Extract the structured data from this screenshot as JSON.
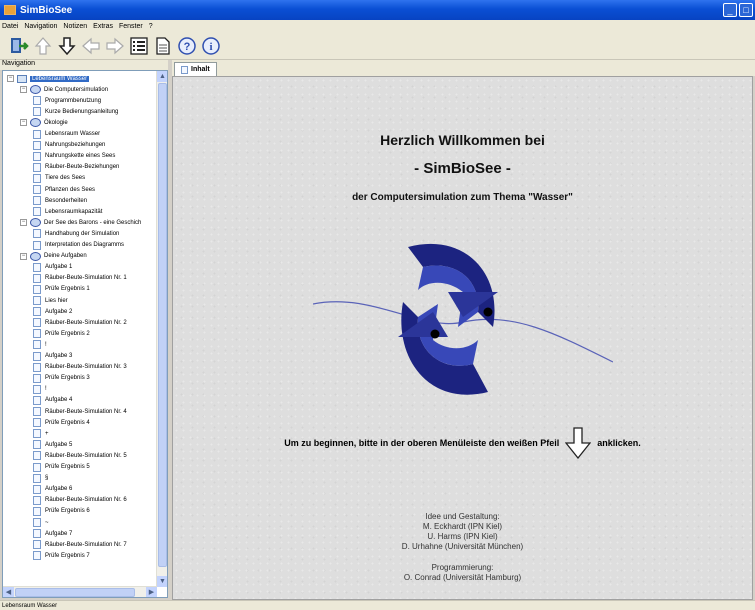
{
  "window": {
    "title": "SimBioSee"
  },
  "menu": [
    "Datei",
    "Navigation",
    "Notizen",
    "Extras",
    "Fenster",
    "?"
  ],
  "toolbar": {
    "icons": [
      "exit-icon",
      "up-icon",
      "down-icon",
      "back-icon",
      "forward-icon",
      "list-icon",
      "page-icon",
      "help-icon",
      "info-icon"
    ]
  },
  "navigation": {
    "label": "Navigation",
    "root": "Lebensraum Wasser",
    "sections": [
      {
        "label": "Die Computersimulation",
        "items": [
          "Programmbenutzung",
          "Kurze Bedienungsanleitung"
        ]
      },
      {
        "label": "Ökologie",
        "items": [
          "Lebensraum Wasser",
          "Nahrungsbeziehungen",
          "Nahrungskette eines Sees",
          "Räuber-Beute-Beziehungen",
          "Tiere des Sees",
          "Pflanzen des Sees",
          "Besonderheiten",
          "Lebensraumkapazität"
        ]
      },
      {
        "label": "Der See des Barons - eine Geschich",
        "items": [
          "Handhabung der Simulation",
          "Interpretation des Diagramms"
        ]
      },
      {
        "label": "Deine Aufgaben",
        "items": [
          "Aufgabe 1",
          "Räuber-Beute-Simulation Nr. 1",
          "Prüfe Ergebnis 1",
          "Lies hier",
          "Aufgabe 2",
          "Räuber-Beute-Simulation Nr. 2",
          "Prüfe Ergebnis 2",
          "!",
          "Aufgabe 3",
          "Räuber-Beute-Simulation Nr. 3",
          "Prüfe Ergebnis 3",
          "!",
          "Aufgabe 4",
          "Räuber-Beute-Simulation Nr. 4",
          "Prüfe Ergebnis 4",
          "+",
          "Aufgabe 5",
          "Räuber-Beute-Simulation Nr. 5",
          "Prüfe Ergebnis 5",
          "§",
          "Aufgabe 6",
          "Räuber-Beute-Simulation Nr. 6",
          "Prüfe Ergebnis 6",
          "~",
          "Aufgabe 7",
          "Räuber-Beute-Simulation Nr. 7",
          "Prüfe Ergebnis 7"
        ]
      }
    ]
  },
  "tab": {
    "label": "Inhalt"
  },
  "content": {
    "welcome": "Herzlich Willkommen bei",
    "app_name": "- SimBioSee -",
    "subtitle": "der Computersimulation zum Thema \"Wasser\"",
    "instruction_before": "Um zu beginnen, bitte in der oberen Menüleiste den weißen Pfeil",
    "instruction_after": "anklicken.",
    "credits": {
      "heading1": "Idee und Gestaltung:",
      "line1": "M. Eckhardt (IPN Kiel)",
      "line2": "U. Harms (IPN Kiel)",
      "line3": "D. Urhahne (Universität München)",
      "heading2": "Programmierung:",
      "line4": "O. Conrad (Universität Hamburg)"
    }
  },
  "status": {
    "text": "Lebensraum Wasser"
  },
  "colors": {
    "logo_dark": "#1c2380",
    "logo_mid": "#3848b8",
    "titlebar": "#0a4fd4"
  }
}
